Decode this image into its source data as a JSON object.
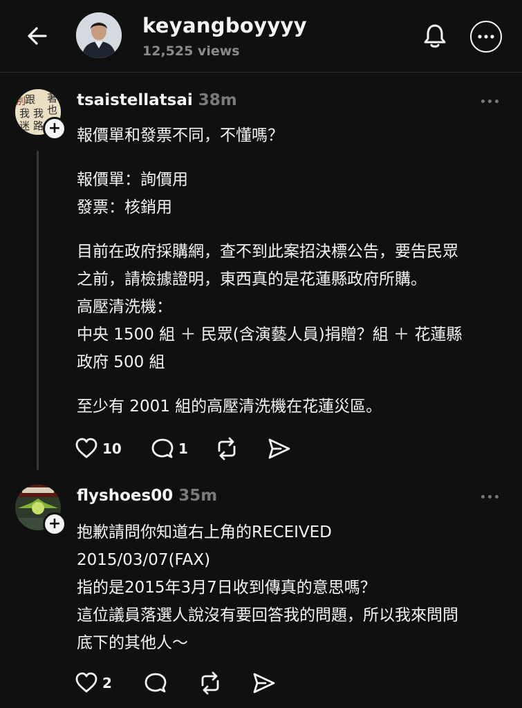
{
  "header": {
    "username": "keyangboyyyy",
    "views": "12,525 views"
  },
  "posts": [
    {
      "username": "tsaistellatsai",
      "time": "38m",
      "avatar_text": [
        "著",
        "跟",
        "別",
        "也",
        "我",
        "我",
        "路",
        "迷"
      ],
      "lines": [
        "報價單和發票不同，不懂嗎？",
        "",
        "報價單：詢價用",
        "發票：核銷用",
        "",
        "目前在政府採購網，查不到此案招決標公告，要告民眾",
        "之前，請檢據證明，東西真的是花蓮縣政府所購。",
        "高壓清洗機：",
        "中央 1500 組 ＋ 民眾(含演藝人員)捐贈？組 ＋ 花蓮縣",
        "政府 500 組",
        "",
        "至少有 2001 組的高壓清洗機在花蓮災區。"
      ],
      "likes": "10",
      "replies": "1"
    },
    {
      "username": "flyshoes00",
      "time": "35m",
      "lines": [
        "抱歉請問你知道右上角的RECEIVED",
        "2015/03/07(FAX)",
        "指的是2015年3月7日收到傳真的意思嗎？",
        "這位議員落選人說沒有要回答我的問題，所以我來問問",
        "底下的其他人～"
      ],
      "likes": "2"
    }
  ],
  "icons": [
    "back-arrow-icon",
    "bell-icon",
    "more-icon",
    "heart-icon",
    "comment-icon",
    "repost-icon",
    "share-icon"
  ]
}
